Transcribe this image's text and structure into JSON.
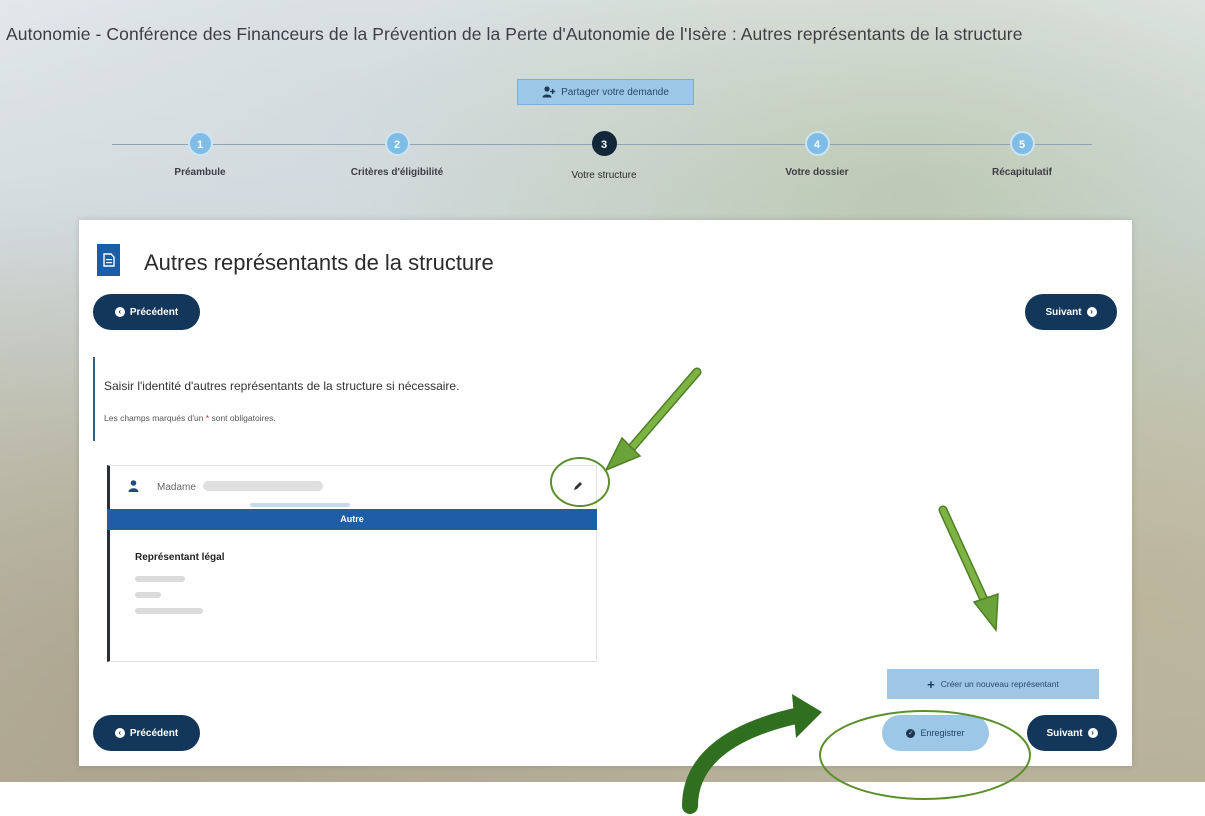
{
  "page": {
    "title": "Autonomie - Conférence des Financeurs de la Prévention de la Perte d'Autonomie de l'Isère : Autres représentants de la structure"
  },
  "share_button": {
    "label": "Partager votre demande",
    "icon": "user-plus-icon"
  },
  "stepper": {
    "steps": [
      {
        "number": "1",
        "label": "Préambule",
        "state": "done"
      },
      {
        "number": "2",
        "label": "Critères d'éligibilité",
        "state": "done"
      },
      {
        "number": "3",
        "label": "Votre structure",
        "state": "active"
      },
      {
        "number": "4",
        "label": "Votre dossier",
        "state": "todo"
      },
      {
        "number": "5",
        "label": "Récapitulatif",
        "state": "todo"
      }
    ]
  },
  "card": {
    "title": "Autres représentants de la structure",
    "title_icon": "document-icon",
    "previous_label": "Précédent",
    "next_label": "Suivant"
  },
  "info": {
    "main": "Saisir l'identité d'autres représentants de la structure si nécessaire.",
    "sub_before": "Les champs marqués d'un ",
    "sub_star": "*",
    "sub_after": " sont obligatoires."
  },
  "representative": {
    "civility": "Madame",
    "category": "Autre",
    "role": "Représentant légal",
    "icons": {
      "user": "user-icon",
      "edit": "pencil-icon"
    }
  },
  "actions": {
    "create_label": "Créer un nouveau représentant",
    "save_label": "Enregistrer"
  },
  "colors": {
    "primary_dark": "#12375a",
    "band_blue": "#1f5ea6",
    "light_blue": "#9cc7e6",
    "annotation_green": "#5b8f2e",
    "required_star": "#d0282a"
  }
}
